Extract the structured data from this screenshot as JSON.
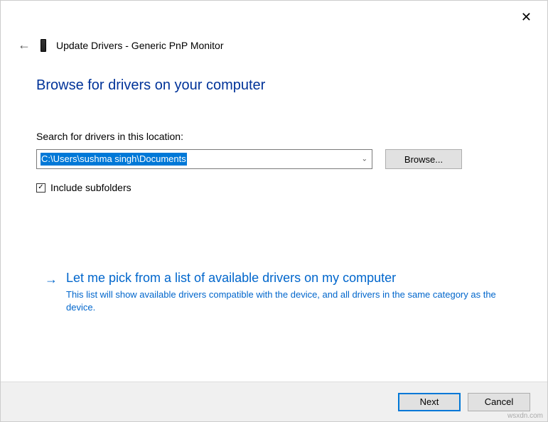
{
  "header": {
    "title": "Update Drivers - Generic PnP Monitor"
  },
  "page": {
    "title": "Browse for drivers on your computer",
    "search_label": "Search for drivers in this location:",
    "path_value": "C:\\Users\\sushma singh\\Documents",
    "browse_button": "Browse...",
    "include_subfolders_label": "Include subfolders",
    "include_subfolders_checked": true
  },
  "option": {
    "title": "Let me pick from a list of available drivers on my computer",
    "description": "This list will show available drivers compatible with the device, and all drivers in the same category as the device."
  },
  "footer": {
    "next": "Next",
    "cancel": "Cancel"
  },
  "watermark": "wsxdn.com"
}
